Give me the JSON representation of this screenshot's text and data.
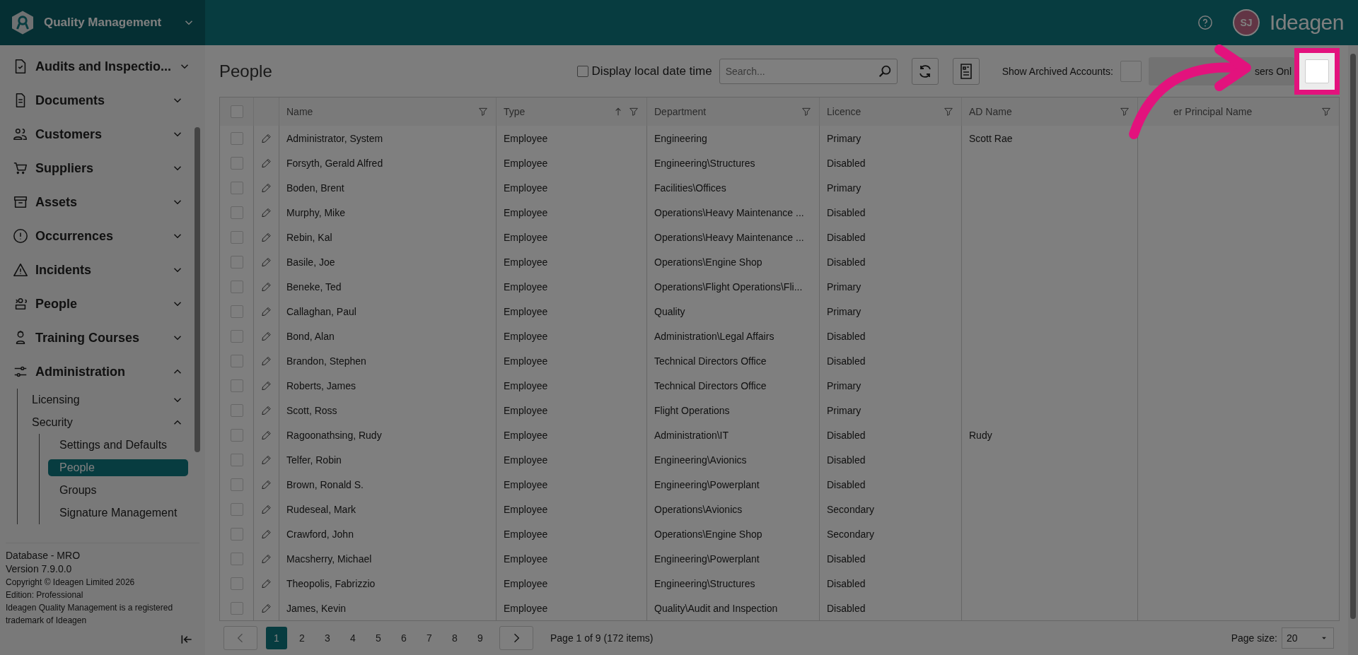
{
  "topbar": {
    "product": "Quality Management",
    "avatar": "SJ",
    "brand": "Ideagen"
  },
  "sidebar": {
    "items": [
      {
        "label": "Audits and Inspectio...",
        "expanded": false
      },
      {
        "label": "Documents",
        "expanded": false
      },
      {
        "label": "Customers",
        "expanded": false
      },
      {
        "label": "Suppliers",
        "expanded": false
      },
      {
        "label": "Assets",
        "expanded": false
      },
      {
        "label": "Occurrences",
        "expanded": false
      },
      {
        "label": "Incidents",
        "expanded": false
      },
      {
        "label": "People",
        "expanded": false
      },
      {
        "label": "Training Courses",
        "expanded": false
      },
      {
        "label": "Administration",
        "expanded": true,
        "children": [
          {
            "label": "Licensing",
            "expanded": false
          },
          {
            "label": "Security",
            "expanded": true,
            "children": [
              {
                "label": "Settings and Defaults",
                "selected": false
              },
              {
                "label": "People",
                "selected": true
              },
              {
                "label": "Groups",
                "selected": false
              },
              {
                "label": "Signature Management",
                "selected": false
              }
            ]
          }
        ]
      }
    ],
    "footer": [
      "Database - MRO",
      "Version 7.9.0.0",
      "Copyright © Ideagen Limited 2026",
      "Edition: Professional",
      "Ideagen Quality Management is a registered trademark of Ideagen"
    ]
  },
  "page": {
    "title": "People",
    "local_time": {
      "label": "Display local date time",
      "checked": false
    },
    "search": {
      "placeholder": "Search..."
    },
    "archived": {
      "label": "Show Archived Accounts:",
      "checked": false
    },
    "users_only": {
      "label": "sers Onl",
      "checked": false
    }
  },
  "table": {
    "select_all_checked": false,
    "columns": [
      {
        "label": "Name",
        "sorted": false
      },
      {
        "label": "Type",
        "sorted": true
      },
      {
        "label": "Department",
        "sorted": false
      },
      {
        "label": "Licence",
        "sorted": false
      },
      {
        "label": "AD Name",
        "sorted": false
      },
      {
        "label": "er Principal Name",
        "sorted": false
      }
    ],
    "rows": [
      {
        "checked": false,
        "cells": [
          "Administrator, System",
          "Employee",
          "Engineering",
          "Primary",
          "Scott Rae"
        ]
      },
      {
        "checked": false,
        "cells": [
          "Forsyth, Gerald Alfred",
          "Employee",
          "Engineering\\Structures",
          "Disabled"
        ]
      },
      {
        "checked": false,
        "cells": [
          "Boden, Brent",
          "Employee",
          "Facilities\\Offices",
          "Primary"
        ]
      },
      {
        "checked": false,
        "cells": [
          "Murphy, Mike",
          "Employee",
          "Operations\\Heavy Maintenance ...",
          "Disabled"
        ]
      },
      {
        "checked": false,
        "cells": [
          "Rebin, Kal",
          "Employee",
          "Operations\\Heavy Maintenance ...",
          "Disabled"
        ]
      },
      {
        "checked": false,
        "cells": [
          "Basile, Joe",
          "Employee",
          "Operations\\Engine Shop",
          "Disabled"
        ]
      },
      {
        "checked": false,
        "cells": [
          "Beneke, Ted",
          "Employee",
          "Operations\\Flight Operations\\Fli...",
          "Primary"
        ]
      },
      {
        "checked": false,
        "cells": [
          "Callaghan, Paul",
          "Employee",
          "Quality",
          "Primary"
        ]
      },
      {
        "checked": false,
        "cells": [
          "Bond, Alan",
          "Employee",
          "Administration\\Legal Affairs",
          "Disabled"
        ]
      },
      {
        "checked": false,
        "cells": [
          "Brandon, Stephen",
          "Employee",
          "Technical Directors Office",
          "Disabled"
        ]
      },
      {
        "checked": false,
        "cells": [
          "Roberts, James",
          "Employee",
          "Technical Directors Office",
          "Primary"
        ]
      },
      {
        "checked": false,
        "cells": [
          "Scott, Ross",
          "Employee",
          "Flight Operations",
          "Primary"
        ]
      },
      {
        "checked": false,
        "cells": [
          "Ragoonathsing, Rudy",
          "Employee",
          "Administration\\IT",
          "Disabled",
          "Rudy"
        ]
      },
      {
        "checked": false,
        "cells": [
          "Telfer, Robin",
          "Employee",
          "Engineering\\Avionics",
          "Disabled"
        ]
      },
      {
        "checked": false,
        "cells": [
          "Brown, Ronald S.",
          "Employee",
          "Engineering\\Powerplant",
          "Disabled"
        ]
      },
      {
        "checked": false,
        "cells": [
          "Rudeseal, Mark",
          "Employee",
          "Operations\\Avionics",
          "Secondary"
        ]
      },
      {
        "checked": false,
        "cells": [
          "Crawford, John",
          "Employee",
          "Operations\\Engine Shop",
          "Secondary"
        ]
      },
      {
        "checked": false,
        "cells": [
          "Macsherry, Michael",
          "Employee",
          "Engineering\\Powerplant",
          "Disabled"
        ]
      },
      {
        "checked": false,
        "cells": [
          "Theopolis, Fabrizzio",
          "Employee",
          "Engineering\\Structures",
          "Disabled"
        ]
      },
      {
        "checked": false,
        "cells": [
          "James, Kevin",
          "Employee",
          "Quality\\Audit and Inspection",
          "Disabled"
        ]
      }
    ]
  },
  "pager": {
    "pages": [
      {
        "label": "1",
        "selected": true
      },
      {
        "label": "2",
        "selected": false
      },
      {
        "label": "3",
        "selected": false
      },
      {
        "label": "4",
        "selected": false
      },
      {
        "label": "5",
        "selected": false
      },
      {
        "label": "6",
        "selected": false
      },
      {
        "label": "7",
        "selected": false
      },
      {
        "label": "8",
        "selected": false
      },
      {
        "label": "9",
        "selected": false
      }
    ],
    "summary": "Page 1 of 9 (172 items)",
    "size_label": "Page size:",
    "size": "20"
  }
}
